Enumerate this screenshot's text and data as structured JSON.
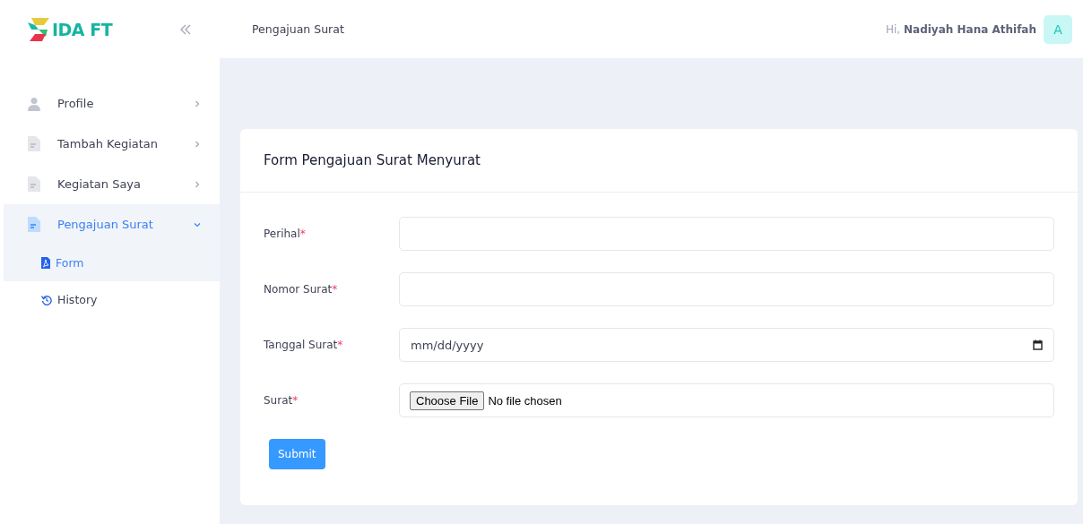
{
  "sidebar": {
    "logo": "IDA FT",
    "items": [
      {
        "label": "Profile",
        "kind": "person",
        "selected": false,
        "expanded": false
      },
      {
        "label": "Tambah Kegiatan",
        "kind": "document",
        "selected": false,
        "expanded": false
      },
      {
        "label": "Kegiatan Saya",
        "kind": "document",
        "selected": false,
        "expanded": false
      },
      {
        "label": "Pengajuan Surat",
        "kind": "document",
        "selected": true,
        "expanded": true,
        "children": [
          {
            "label": "Form",
            "kind": "pdf",
            "selected": true
          },
          {
            "label": "History",
            "kind": "history",
            "selected": false
          }
        ]
      }
    ]
  },
  "header": {
    "title": "Pengajuan Surat",
    "greeting": "Hi,",
    "user": "Nadiyah Hana Athifah",
    "avatar": "A"
  },
  "form": {
    "title": "Form Pengajuan Surat Menyurat",
    "fields": [
      {
        "label": "Perihal",
        "required": true,
        "kind": "text"
      },
      {
        "label": "Nomor Surat",
        "required": true,
        "kind": "text"
      },
      {
        "label": "Tanggal Surat",
        "required": true,
        "kind": "date",
        "placeholder": "mm/dd/yyyy"
      },
      {
        "label": "Surat",
        "required": true,
        "kind": "file",
        "button": "Choose File",
        "status": "No file chosen"
      }
    ],
    "required_mark": "*",
    "submit": "Submit"
  }
}
